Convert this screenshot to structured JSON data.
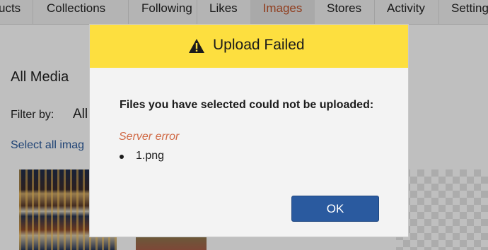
{
  "nav": {
    "tabs": [
      {
        "label": "ucts",
        "active": false
      },
      {
        "label": "Collections",
        "active": false
      },
      {
        "label": "Following",
        "active": false
      },
      {
        "label": "Likes",
        "active": false
      },
      {
        "label": "Images",
        "active": true
      },
      {
        "label": "Stores",
        "active": false
      },
      {
        "label": "Activity",
        "active": false
      },
      {
        "label": "Setting",
        "active": false
      }
    ],
    "active_color": "#c0532a"
  },
  "media": {
    "title": "All Media",
    "filter_label": "Filter by:",
    "filter_value": "All",
    "select_all": "Select all imag"
  },
  "modal": {
    "header_icon": "warning-icon",
    "title": "Upload Failed",
    "message": "Files you have selected could not be uploaded:",
    "error": "Server error",
    "files": [
      "1.png"
    ],
    "ok_label": "OK",
    "header_color": "#fddf3f",
    "button_color": "#2a5a9f",
    "error_color": "#d06a46"
  }
}
